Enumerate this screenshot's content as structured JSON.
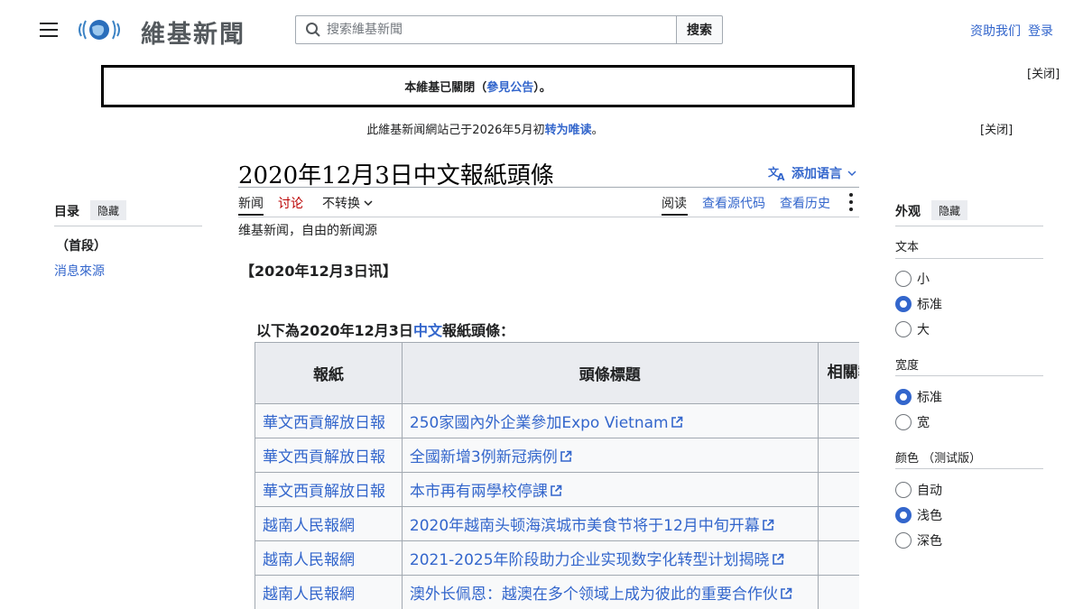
{
  "header": {
    "site_name": "維基新聞",
    "search_placeholder": "搜索維基新聞",
    "search_button": "搜索",
    "donate": "资助我们",
    "login": "登录"
  },
  "banners": {
    "closure_prefix": "本維基已關閉（",
    "closure_link": "參見公告",
    "closure_suffix": "）。",
    "dismiss": "[关闭]",
    "readonly_prefix": "此維基新闻網站己于2026年5月初",
    "readonly_link": "转为唯读",
    "readonly_suffix": "。"
  },
  "title": "2020年12月3日中文報紙頭條",
  "lang_button": "添加语言",
  "tabs": {
    "news": "新闻",
    "talk": "讨论",
    "variant": "不转换",
    "read": "阅读",
    "source": "查看源代码",
    "history": "查看历史"
  },
  "tagline": "维基新闻，自由的新闻源",
  "dateline": "【2020年12月3日讯】",
  "intro": {
    "prefix": "以下為2020年12月3日",
    "link": "中文",
    "suffix": "報紙頭條："
  },
  "table": {
    "headers": [
      "報紙",
      "頭條標題",
      "相關報導"
    ],
    "rows": [
      {
        "paper": "華文西貢解放日報",
        "headline": "250家國內外企業參加Expo Vietnam"
      },
      {
        "paper": "華文西貢解放日報",
        "headline": "全國新增3例新冠病例"
      },
      {
        "paper": "華文西貢解放日報",
        "headline": "本市再有兩學校停課"
      },
      {
        "paper": "越南人民報網",
        "headline": "2020年越南头顿海滨城市美食节将于12月中旬开幕"
      },
      {
        "paper": "越南人民報網",
        "headline": "2021-2025年阶段助力企业实现数字化转型计划揭晓"
      },
      {
        "paper": "越南人民報網",
        "headline": "澳外长佩恩：越澳在多个领域上成为彼此的重要合作伙"
      }
    ]
  },
  "toc": {
    "heading": "目录",
    "hide": "隐藏",
    "items": [
      "（首段）",
      "消息來源"
    ]
  },
  "appearance": {
    "heading": "外观",
    "hide": "隐藏",
    "text_label": "文本",
    "text_options": [
      "小",
      "标准",
      "大"
    ],
    "text_selected": "标准",
    "width_label": "宽度",
    "width_options": [
      "标准",
      "宽"
    ],
    "width_selected": "标准",
    "color_label": "颜色 （测试版）",
    "color_options": [
      "自动",
      "浅色",
      "深色"
    ],
    "color_selected": "浅色"
  }
}
